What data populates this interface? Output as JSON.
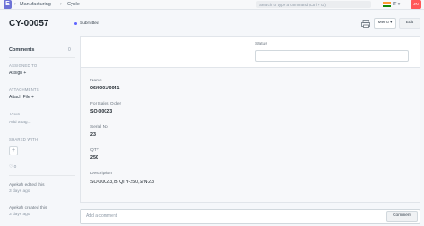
{
  "navbar": {
    "logo": "E",
    "breadcrumbs": [
      "Manufacturing",
      "Cycle"
    ],
    "search_placeholder": "Search or type a command (Ctrl + G)",
    "lang": "IT",
    "user_initials": "JN"
  },
  "header": {
    "title": "CY-00057",
    "status": "Submitted",
    "menu_label": "Menu",
    "edit_label": "Edit"
  },
  "sidebar": {
    "comments_label": "Comments",
    "comments_count": "0",
    "assigned_to_label": "ASSIGNED TO",
    "assign_label": "Assign +",
    "attachments_label": "ATTACHMENTS",
    "attach_label": "Attach File +",
    "tags_label": "TAGS",
    "add_tag": "Add a tag...",
    "shared_label": "SHARED WITH",
    "likes": "♡ 0",
    "activity": [
      {
        "text": "Apekah edited this",
        "time": "3 days ago"
      },
      {
        "text": "Apekah created this",
        "time": "3 days ago"
      }
    ]
  },
  "form": {
    "status_label": "Status",
    "fields": [
      {
        "label": "Name",
        "value": "06/0001/0041"
      },
      {
        "label": "For Sales Order",
        "value": "SO-00023"
      },
      {
        "label": "Serial No",
        "value": "23"
      },
      {
        "label": "QTY",
        "value": "250"
      },
      {
        "label": "Description",
        "value": "SO-00023, B QTY-250,S/N-23"
      }
    ]
  },
  "comment": {
    "placeholder": "Add a comment",
    "button": "Comment"
  },
  "colors": {
    "logo": "#6e73d6",
    "avatar": "#ff5858",
    "status_dot": "#5e64ff"
  }
}
